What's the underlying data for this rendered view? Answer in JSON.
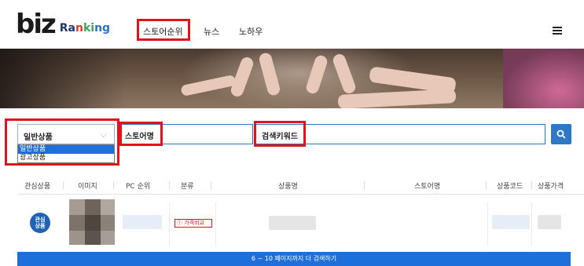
{
  "logo": {
    "mark": "biz",
    "ranking_letters": [
      "Ra",
      "n",
      "ki",
      "ng"
    ]
  },
  "nav": {
    "items": [
      {
        "label": "스토어순위"
      },
      {
        "label": "뉴스"
      },
      {
        "label": "노하우"
      }
    ],
    "menu_icon": "hamburger-icon"
  },
  "search": {
    "product_type": {
      "selected": "일반상품",
      "options": [
        "일반상품",
        "광고상품"
      ]
    },
    "store_name_label": "스토어명",
    "keyword_label": "검색키워드",
    "search_icon": "search-icon"
  },
  "table": {
    "headers": [
      "관심상품",
      "이미지",
      "PC 순위",
      "분류",
      "상품명",
      "스토어명",
      "상품코드",
      "상품가격"
    ],
    "row": {
      "interest_badge": "관심\n상품",
      "price_compare": "가격비교"
    }
  },
  "more_button": "6 ~ 10 페이지까지 더 검색하기",
  "colors": {
    "accent_blue": "#1e6fd9",
    "highlight_red": "#e3131b"
  }
}
